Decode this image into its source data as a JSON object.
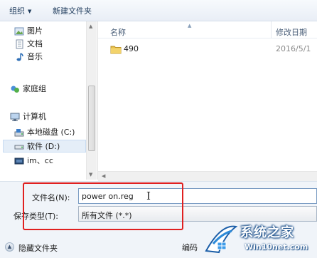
{
  "toolbar": {
    "organize_label": "组织",
    "new_folder_label": "新建文件夹"
  },
  "nav": {
    "libraries": [
      {
        "label": "图片",
        "icon": "pictures-icon"
      },
      {
        "label": "文档",
        "icon": "documents-icon"
      },
      {
        "label": "音乐",
        "icon": "music-icon"
      }
    ],
    "homegroup": {
      "label": "家庭组",
      "icon": "homegroup-icon"
    },
    "computer": {
      "label": "计算机",
      "icon": "computer-icon"
    },
    "drives": [
      {
        "label": "本地磁盘 (C:)",
        "icon": "local-disk-icon",
        "selected": false
      },
      {
        "label": "软件 (D:)",
        "icon": "drive-icon",
        "selected": true
      },
      {
        "label": "im、cc",
        "icon": "drive-icon",
        "selected": false
      }
    ]
  },
  "filelist": {
    "columns": {
      "name": "名称",
      "date_modified": "修改日期"
    },
    "files": [
      {
        "name": "490",
        "date": "2016/5/1",
        "icon": "folder-icon"
      }
    ]
  },
  "save": {
    "filename_label": "文件名(N):",
    "filename_value": "power on.reg",
    "filetype_label": "保存类型(T):",
    "filetype_value": "所有文件 (*.*)",
    "hide_folders_label": "隐藏文件夹",
    "encoding_label": "编码"
  },
  "watermark": {
    "title": "系统之家",
    "url": "Win10net.com"
  },
  "colors": {
    "highlight_border": "#e02020",
    "folder": "#e8c04a",
    "selection": "#e5eef8"
  }
}
